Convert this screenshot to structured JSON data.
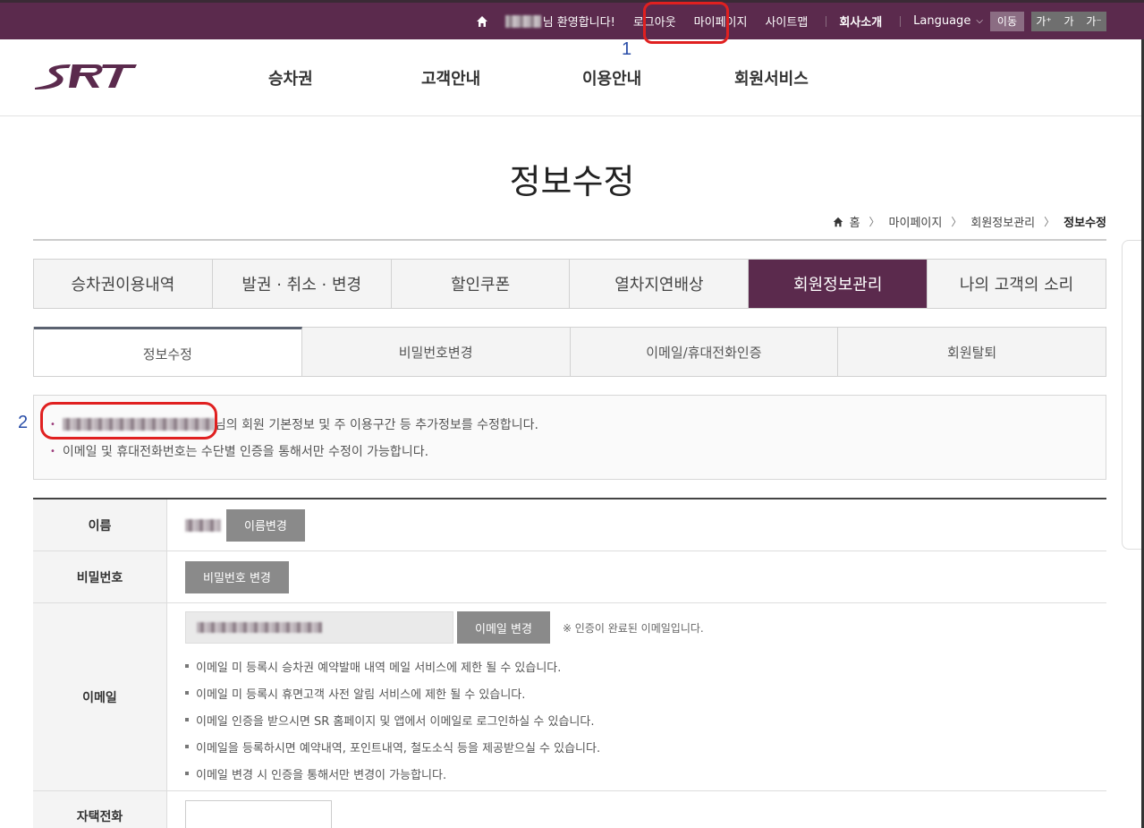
{
  "topbar": {
    "welcome": "님 환영합니다!",
    "logout": "로그아웃",
    "mypage": "마이페이지",
    "sitemap": "사이트맵",
    "company": "회사소개",
    "language": "Language",
    "move": "이동",
    "font_up": "가⁺",
    "font_normal": "가",
    "font_down": "가⁻"
  },
  "annotations": {
    "one": "1",
    "two": "2"
  },
  "gnb": [
    "승차권",
    "고객안내",
    "이용안내",
    "회원서비스"
  ],
  "page": {
    "title": "정보수정"
  },
  "breadcrumb": [
    "홈",
    "마이페이지",
    "회원정보관리",
    "정보수정"
  ],
  "main_tabs": [
    "승차권이용내역",
    "발권 · 취소 · 변경",
    "할인쿠폰",
    "열차지연배상",
    "회원정보관리",
    "나의 고객의 소리"
  ],
  "sub_tabs": [
    "정보수정",
    "비밀번호변경",
    "이메일/휴대전화인증",
    "회원탈퇴"
  ],
  "notice": {
    "line1_suffix": "님의 회원 기본정보 및 주 이용구간 등 추가정보를 수정합니다.",
    "line2": "이메일 및 휴대전화번호는 수단별 인증을 통해서만 수정이 가능합니다."
  },
  "form": {
    "name_label": "이름",
    "name_button": "이름변경",
    "password_label": "비밀번호",
    "password_button": "비밀번호 변경",
    "email_label": "이메일",
    "email_button": "이메일 변경",
    "email_note": "※ 인증이 완료된 이메일입니다.",
    "email_notes": [
      "이메일 미 등록시 승차권 예약발매 내역 메일 서비스에 제한 될 수 있습니다.",
      "이메일 미 등록시 휴면고객 사전 알림 서비스에 제한 될 수 있습니다.",
      "이메일 인증을 받으시면 SR 홈페이지 및 앱에서 이메일로 로그인하실 수 있습니다.",
      "이메일을 등록하시면 예약내역, 포인트내역, 철도소식 등을 제공받으실 수 있습니다.",
      "이메일 변경 시 인증을 통해서만 변경이 가능합니다."
    ],
    "home_phone_label": "자택전화"
  },
  "colors": {
    "brand": "#5b2a4d",
    "highlight": "#e02020",
    "annotation": "#2a4ea8"
  }
}
